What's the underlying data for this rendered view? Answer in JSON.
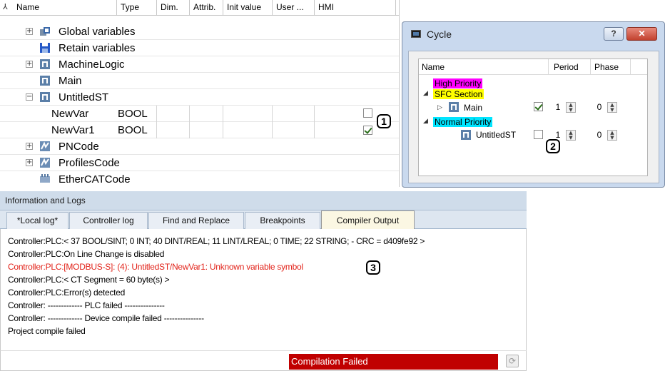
{
  "var_tree": {
    "columns": [
      "Name",
      "Type",
      "Dim.",
      "Attrib.",
      "Init value",
      "User ...",
      "HMI"
    ],
    "items": [
      {
        "label": "Global variables",
        "expander": "+",
        "icon": "global-variables-icon"
      },
      {
        "label": "Retain variables",
        "expander": "",
        "icon": "retain-save-icon"
      },
      {
        "label": "MachineLogic",
        "expander": "+",
        "icon": "program-module-icon"
      },
      {
        "label": "Main",
        "expander": "",
        "icon": "program-module-icon"
      },
      {
        "label": "UntitledST",
        "expander": "−",
        "icon": "program-module-icon"
      }
    ],
    "variables": [
      {
        "name": "NewVar",
        "type": "BOOL",
        "hmi_checked": false
      },
      {
        "name": "NewVar1",
        "type": "BOOL",
        "hmi_checked": true
      }
    ],
    "items_after": [
      {
        "label": "PNCode",
        "expander": "+",
        "icon": "profinet-code-icon"
      },
      {
        "label": "ProfilesCode",
        "expander": "+",
        "icon": "profiles-code-icon"
      },
      {
        "label": "EtherCATCode",
        "expander": "",
        "icon": "ethercat-code-icon"
      }
    ]
  },
  "cycle_dialog": {
    "title": "Cycle",
    "help_label": "?",
    "close_label": "✕",
    "columns": {
      "name": "Name",
      "period": "Period",
      "phase": "Phase"
    },
    "high_priority": "High Priority",
    "sfc_section": "SFC Section",
    "normal_priority": "Normal Priority",
    "main": {
      "label": "Main",
      "checked": true,
      "period": "1",
      "phase": "0"
    },
    "untitled": {
      "label": "UntitledST",
      "checked": false,
      "period": "1",
      "phase": "0"
    },
    "colors": {
      "high": "#ff00ff",
      "sfc": "#ffff00",
      "normal": "#00e5ff"
    }
  },
  "callouts": {
    "one": "1",
    "two": "2",
    "three": "3"
  },
  "logs": {
    "title": "Information and Logs",
    "tabs": [
      "*Local log*",
      "Controller log",
      "Find and Replace",
      "Breakpoints",
      "Compiler Output"
    ],
    "active_tab": "Compiler Output",
    "lines": [
      {
        "text": "Controller:PLC:< 37 BOOL/SINT; 0 INT; 40 DINT/REAL; 11 LINT/LREAL; 0 TIME; 22 STRING;  - CRC = d409fe92 >",
        "error": false
      },
      {
        "text": "Controller:PLC:On Line Change is disabled",
        "error": false
      },
      {
        "text": "Controller:PLC:[MODBUS-S]: (4): UntitledST/NewVar1: Unknown variable symbol",
        "error": true
      },
      {
        "text": "Controller:PLC:< CT Segment = 60 byte(s) >",
        "error": false
      },
      {
        "text": "Controller:PLC:Error(s) detected",
        "error": false
      },
      {
        "text": "Controller: ------------- PLC failed ---------------",
        "error": false
      },
      {
        "text": "Controller: ------------- Device compile failed ---------------",
        "error": false
      },
      {
        "text": "Project compile failed",
        "error": false
      }
    ],
    "status": "Compilation Failed",
    "status_color": "#c00000"
  }
}
